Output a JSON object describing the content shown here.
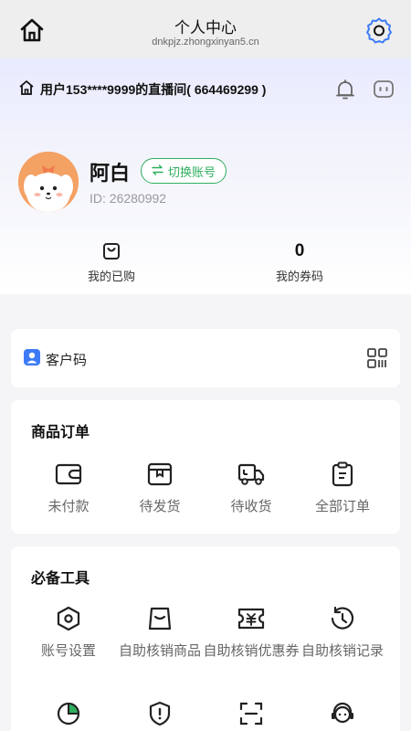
{
  "appbar": {
    "title": "个人中心",
    "url": "dnkpjz.zhongxinyan5.cn"
  },
  "room": {
    "text": "用户153****9999的直播间( 664469299 )"
  },
  "profile": {
    "name": "阿白",
    "switch_label": "切换账号",
    "id_text": "ID: 26280992"
  },
  "stats": [
    {
      "label": "我的已购",
      "icon": "shopping-bag-icon"
    },
    {
      "value": "0",
      "label": "我的券码"
    }
  ],
  "customer": {
    "label": "客户码"
  },
  "orders": {
    "title": "商品订单",
    "items": [
      {
        "label": "未付款",
        "icon": "wallet-icon"
      },
      {
        "label": "待发货",
        "icon": "package-icon"
      },
      {
        "label": "待收货",
        "icon": "truck-icon"
      },
      {
        "label": "全部订单",
        "icon": "clipboard-icon"
      }
    ]
  },
  "tools": {
    "title": "必备工具",
    "items": [
      {
        "label": "账号设置",
        "icon": "hexagon-settings-icon"
      },
      {
        "label": "自助核销商品",
        "icon": "bag-icon"
      },
      {
        "label": "自助核销优惠券",
        "icon": "coupon-icon"
      },
      {
        "label": "自助核销记录",
        "icon": "history-icon"
      },
      {
        "label": "",
        "icon": "pie-chart-icon"
      },
      {
        "label": "",
        "icon": "shield-alert-icon"
      },
      {
        "label": "",
        "icon": "scan-icon"
      },
      {
        "label": "",
        "icon": "service-icon"
      }
    ]
  },
  "colors": {
    "accent_green": "#2fae5e",
    "accent_blue": "#3d7bf5",
    "icon_dark": "#333333"
  }
}
